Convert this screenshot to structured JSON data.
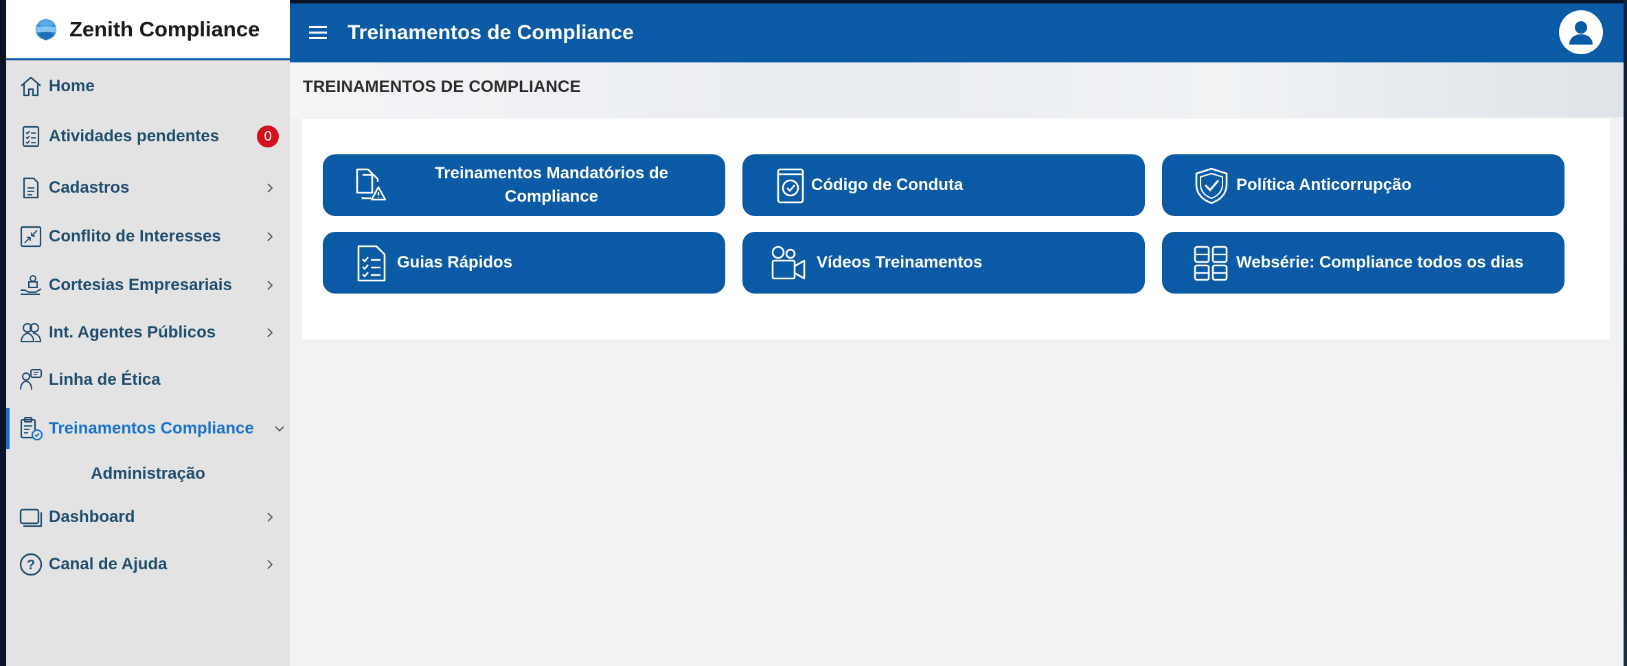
{
  "brand": {
    "name": "Zenith Compliance"
  },
  "header": {
    "title": "Treinamentos de Compliance"
  },
  "sidebar": {
    "items": [
      {
        "label": "Home"
      },
      {
        "label": "Atividades pendentes",
        "badge": "0"
      },
      {
        "label": "Cadastros"
      },
      {
        "label": "Conflito de Interesses"
      },
      {
        "label": "Cortesias Empresariais"
      },
      {
        "label": "Int. Agentes Públicos"
      },
      {
        "label": "Linha de Ética"
      },
      {
        "label": "Treinamentos Compliance"
      },
      {
        "label": "Dashboard"
      },
      {
        "label": "Canal de Ajuda"
      }
    ],
    "subitems": [
      {
        "label": "Administração"
      }
    ]
  },
  "main": {
    "page_title": "TREINAMENTOS DE COMPLIANCE",
    "tiles": [
      {
        "label": "Treinamentos Mandatórios de Compliance",
        "icon": "documents-warning-icon"
      },
      {
        "label": "Código de Conduta",
        "icon": "book-check-icon"
      },
      {
        "label": "Política Anticorrupção",
        "icon": "shield-check-icon"
      },
      {
        "label": "Guias Rápidos",
        "icon": "checklist-icon"
      },
      {
        "label": "Vídeos Treinamentos",
        "icon": "video-camera-icon"
      },
      {
        "label": "Websérie: Compliance todos os dias",
        "icon": "grid-icon"
      }
    ]
  },
  "colors": {
    "primary": "#0a5aa5",
    "active_item": "#1a73c8",
    "badge": "#d1121c",
    "sidebar_text": "#1f4e6e"
  }
}
